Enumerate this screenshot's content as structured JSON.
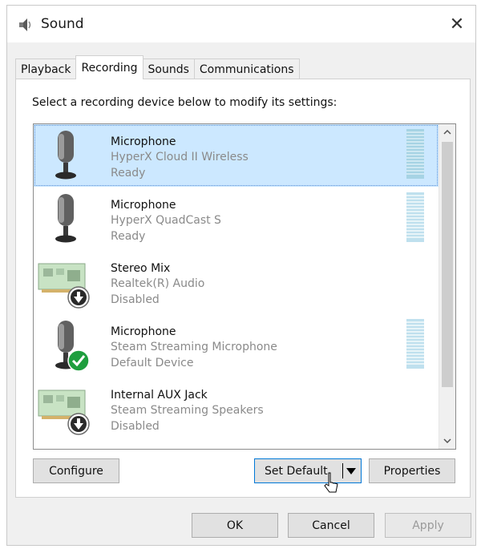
{
  "window": {
    "title": "Sound",
    "icon": "speaker-icon",
    "close_label": "✕"
  },
  "tabs": [
    {
      "label": "Playback",
      "active": false
    },
    {
      "label": "Recording",
      "active": true
    },
    {
      "label": "Sounds",
      "active": false
    },
    {
      "label": "Communications",
      "active": false
    }
  ],
  "instruction": "Select a recording device below to modify its settings:",
  "devices": [
    {
      "name": "Microphone",
      "description": "HyperX Cloud II Wireless",
      "status": "Ready",
      "icon": "microphone-icon",
      "selected": true,
      "has_level_meter": true
    },
    {
      "name": "Microphone",
      "description": "HyperX QuadCast S",
      "status": "Ready",
      "icon": "microphone-icon",
      "selected": false,
      "has_level_meter": true
    },
    {
      "name": "Stereo Mix",
      "description": "Realtek(R) Audio",
      "status": "Disabled",
      "icon": "sound-card-icon",
      "badge": "disabled-arrow-icon",
      "selected": false,
      "has_level_meter": false
    },
    {
      "name": "Microphone",
      "description": "Steam Streaming Microphone",
      "status": "Default Device",
      "icon": "microphone-icon",
      "badge": "default-check-icon",
      "selected": false,
      "has_level_meter": true
    },
    {
      "name": "Internal AUX Jack",
      "description": "Steam Streaming Speakers",
      "status": "Disabled",
      "icon": "sound-card-icon",
      "badge": "disabled-arrow-icon",
      "selected": false,
      "has_level_meter": false
    }
  ],
  "buttons": {
    "configure": "Configure",
    "set_default": "Set Default",
    "properties": "Properties",
    "ok": "OK",
    "cancel": "Cancel",
    "apply": "Apply"
  },
  "colors": {
    "selection": "#cce8ff",
    "default_badge": "#1e9e3e",
    "focus_border": "#0078d7",
    "level_meter": "#bfe0ee"
  }
}
